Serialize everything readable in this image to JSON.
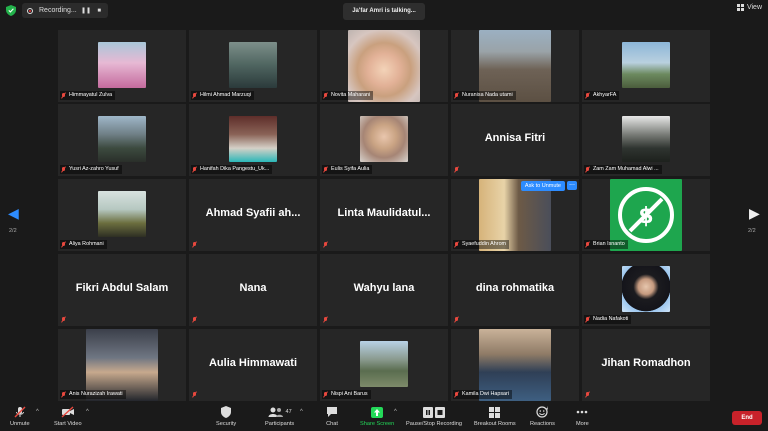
{
  "topbar": {
    "recording_label": "Recording...",
    "talking_label": "Ja'far Amri is talking...",
    "view_label": "View"
  },
  "navigation": {
    "page_left": "2/2",
    "page_right": "2/2"
  },
  "tiles": [
    {
      "name": "Himmayatul Zulva",
      "big": ""
    },
    {
      "name": "Hilmi Ahmad Marzuqi",
      "big": ""
    },
    {
      "name": "Novita Maharani",
      "big": ""
    },
    {
      "name": "Nuranisa Nada utami",
      "big": ""
    },
    {
      "name": "AkhyarFA",
      "big": ""
    },
    {
      "name": "Yusri Az-zahro Yusuf",
      "big": ""
    },
    {
      "name": "Hanifah Dika Pangestu_Uk...",
      "big": ""
    },
    {
      "name": "Eulis Syifa Aulia",
      "big": ""
    },
    {
      "name": "",
      "big": "Annisa Fitri"
    },
    {
      "name": "Zam Zam Muhamad Alwi ...",
      "big": ""
    },
    {
      "name": "Aliya Rohmani",
      "big": ""
    },
    {
      "name": "",
      "big": "Ahmad Syafii ah..."
    },
    {
      "name": "",
      "big": "Linta Maulidatul..."
    },
    {
      "name": "Syaefuddin Ahrom",
      "big": ""
    },
    {
      "name": "Brian Isnanto",
      "big": ""
    },
    {
      "name": "",
      "big": "Fikri Abdul Salam"
    },
    {
      "name": "",
      "big": "Nana"
    },
    {
      "name": "",
      "big": "Wahyu lana"
    },
    {
      "name": "",
      "big": "dina rohmatika"
    },
    {
      "name": "Nadia Nafakoti",
      "big": ""
    },
    {
      "name": "Anis Nurazizah Irawati",
      "big": ""
    },
    {
      "name": "",
      "big": "Aulia Himmawati"
    },
    {
      "name": "Nispi Ani Barus",
      "big": ""
    },
    {
      "name": "Kamila Dwi Hapsari",
      "big": ""
    },
    {
      "name": "",
      "big": "Jihan Romadhon"
    }
  ],
  "hover": {
    "ask_to_unmute": "Ask to Unmute",
    "more": "..."
  },
  "toolbar": {
    "unmute": "Unmute",
    "start_video": "Start Video",
    "security": "Security",
    "participants": "Participants",
    "participants_count": "47",
    "chat": "Chat",
    "share_screen": "Share Screen",
    "pause_stop_recording": "Pause/Stop Recording",
    "breakout_rooms": "Breakout Rooms",
    "reactions": "Reactions",
    "more": "More",
    "end": "End"
  },
  "colors": {
    "accent": "#2d8cff",
    "share_green": "#23d959",
    "end_red": "#c8222a",
    "muted_red": "#e8483e",
    "tile_bg": "#262626"
  }
}
